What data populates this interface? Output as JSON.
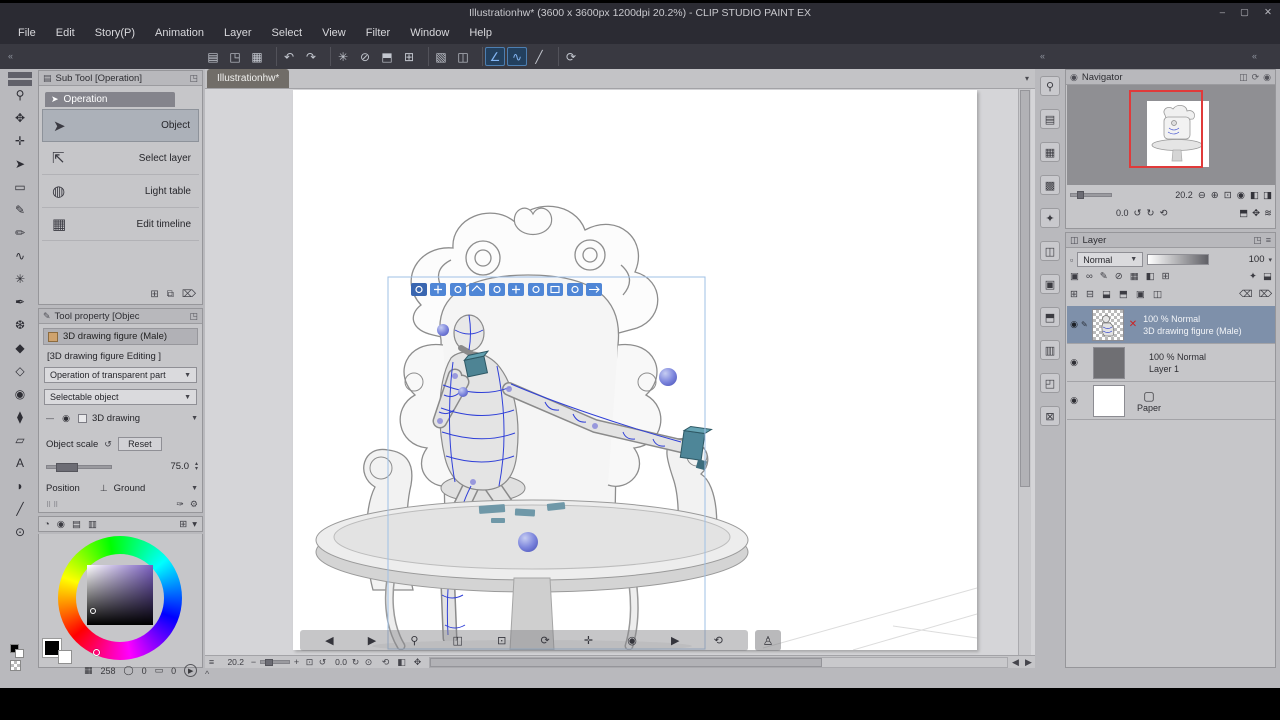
{
  "window": {
    "title": "Illustrationhw* (3600 x 3600px 1200dpi 20.2%)  - CLIP STUDIO PAINT EX",
    "controls": {
      "minimize": "–",
      "maximize": "▢",
      "close": "✕"
    }
  },
  "menu": {
    "items": [
      "File",
      "Edit",
      "Story(P)",
      "Animation",
      "Layer",
      "Select",
      "View",
      "Filter",
      "Window",
      "Help"
    ]
  },
  "cmdbar": {
    "icons": [
      {
        "g": "▤"
      },
      {
        "g": "◳"
      },
      {
        "g": "▦"
      },
      {
        "sep": true
      },
      {
        "g": "↶"
      },
      {
        "g": "↷"
      },
      {
        "sep": true
      },
      {
        "g": "✳"
      },
      {
        "g": "⊘"
      },
      {
        "g": "⬒"
      },
      {
        "g": "⊞"
      },
      {
        "sep": true
      },
      {
        "g": "▧"
      },
      {
        "g": "◫"
      },
      {
        "sep": true
      },
      {
        "g": "∠",
        "active": true
      },
      {
        "g": "∿",
        "active": true
      },
      {
        "g": "╱"
      },
      {
        "sep": true
      },
      {
        "g": "⟳"
      }
    ]
  },
  "toolbox": {
    "tools": [
      {
        "g": "⚲"
      },
      {
        "g": "✥"
      },
      {
        "g": "✛"
      },
      {
        "g": "➤"
      },
      {
        "g": "▭"
      },
      {
        "g": "✎"
      },
      {
        "g": "✏"
      },
      {
        "g": "∿"
      },
      {
        "g": "✳"
      },
      {
        "g": "✒"
      },
      {
        "g": "❆"
      },
      {
        "g": "◆"
      },
      {
        "g": "◇"
      },
      {
        "g": "◉"
      },
      {
        "g": "⧫"
      },
      {
        "g": "▱"
      },
      {
        "g": "A"
      },
      {
        "g": "◗"
      },
      {
        "g": "╱"
      },
      {
        "g": "⊙"
      }
    ]
  },
  "subtool": {
    "header": "Sub Tool [Operation]",
    "group": "Operation",
    "group_icon": "➤",
    "items": [
      {
        "g": "➤",
        "label": "Object"
      },
      {
        "g": "⇱",
        "label": "Select layer"
      },
      {
        "g": "◍",
        "label": "Light table"
      },
      {
        "g": "▦",
        "label": "Edit timeline"
      }
    ],
    "footer": [
      "⊞",
      "⧉",
      "⌦"
    ]
  },
  "toolprop": {
    "header": "Tool property [Objec",
    "name": "3D drawing figure (Male)",
    "edit_label": "[3D drawing figure Editing ]",
    "dd1": "Operation of transparent part",
    "dd2": "Selectable object",
    "row3d_label": "3D drawing",
    "scale_label": "Object scale",
    "reset_label": "Reset",
    "scale_value": "75.0",
    "position_label": "Position",
    "position_value": "Ground",
    "footer_icons": [
      "✑",
      "⚙"
    ]
  },
  "colorbar": {
    "icons": [
      "◔",
      "◉",
      "▤",
      "▥"
    ],
    "right_icons": [
      "⊞",
      "▾"
    ]
  },
  "colorpanel": {
    "display_value": "258",
    "counter1": "0",
    "counter2": "0"
  },
  "canvas": {
    "tab": "Illustrationhw*",
    "zoom": "20.2",
    "rotation": "0.0",
    "launcher": [
      "◀",
      "▶",
      "⚲",
      "◫",
      "⊡",
      "⟳",
      "✛",
      "◉",
      "▶",
      "⟲"
    ],
    "figure_button": "♙",
    "extra_icons": [
      "⟲",
      "◧",
      "✥"
    ]
  },
  "rail": {
    "icons": [
      "⚲",
      "▤",
      "▦",
      "▩",
      "✦",
      "◫",
      "▣",
      "⬒",
      "▥",
      "◰",
      "⊠"
    ]
  },
  "navigator": {
    "title": "Navigator",
    "header_icons": [
      "◫",
      "⟳",
      "◉"
    ],
    "zoom": "20.2",
    "rotation": "0.0",
    "zoom_icons": [
      "⊖",
      "⊕",
      "⊡",
      "◉"
    ],
    "zoom_icons2": [
      "◧",
      "◨"
    ],
    "rot_icons": [
      "↺",
      "↻",
      "⟲"
    ],
    "rot_icons2": [
      "⬒",
      "✥",
      "≋"
    ]
  },
  "layers": {
    "title": "Layer",
    "header_icons": [
      "◳",
      "≡"
    ],
    "blend": "Normal",
    "opacity": "100",
    "cmd1": [
      "▣",
      "∞",
      "✎",
      "⊘",
      "▦",
      "◧",
      "⊞"
    ],
    "cmd1r": [
      "✦",
      "⬓"
    ],
    "cmd2": [
      "⊞",
      "⊟",
      "⬓",
      "⬒",
      "▣",
      "◫"
    ],
    "cmd2r": [
      "⌫",
      "⌦"
    ],
    "rows": [
      {
        "info": "100 % Normal",
        "name": "3D drawing figure (Male)"
      },
      {
        "info": "100 % Normal",
        "name": "Layer 1"
      },
      {
        "info": "",
        "name": "Paper"
      }
    ]
  },
  "icons": {
    "collapse": "«",
    "tab_menu": "▾",
    "canvas_menu": "≡",
    "zoom_out": "−",
    "zoom_in": "+",
    "fit": "⊡",
    "rot_ccw": "↺",
    "rot_cw": "↻",
    "rot_reset": "⊙",
    "scroll_left": "◀",
    "scroll_right": "▶",
    "chevron_up": "^",
    "eye": "◉",
    "pen_indicator": "✎",
    "red_x": "✕",
    "paper": "▢",
    "display": "▦",
    "circle": "◯",
    "square": "▭",
    "play": "▶",
    "grip": "⠿⠿",
    "dash": "—",
    "reset_icon": "↺",
    "ground_icon": "⊥",
    "blend_chip": "▫",
    "stepper": "▾"
  }
}
